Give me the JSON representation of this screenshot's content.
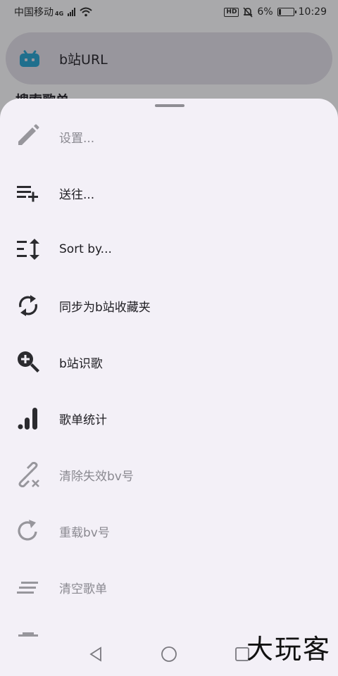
{
  "status": {
    "carrier": "中国移动",
    "network": "4G",
    "battery_percent": "6%",
    "time": "10:29",
    "hd_badge": "HD"
  },
  "search": {
    "icon": "bilibili-tv-icon",
    "text": "b站URL"
  },
  "behind": {
    "label": "搜索歌单"
  },
  "menu": [
    {
      "label": "设置...",
      "icon": "pencil-icon",
      "enabled": false
    },
    {
      "label": "送往...",
      "icon": "playlist-add-icon",
      "enabled": true
    },
    {
      "label": "Sort by...",
      "icon": "sort-icon",
      "enabled": true
    },
    {
      "label": "同步为b站收藏夹",
      "icon": "sync-icon",
      "enabled": true
    },
    {
      "label": "b站识歌",
      "icon": "zoom-in-icon",
      "enabled": true
    },
    {
      "label": "歌单统计",
      "icon": "bar-chart-icon",
      "enabled": true
    },
    {
      "label": "清除失效bv号",
      "icon": "link-off-icon",
      "enabled": false
    },
    {
      "label": "重载bv号",
      "icon": "reload-icon",
      "enabled": false
    },
    {
      "label": "清空歌单",
      "icon": "clear-list-icon",
      "enabled": false
    }
  ],
  "nav": {
    "back_icon": "back-triangle-icon",
    "home_icon": "home-circle-icon",
    "recents_icon": "recents-square-icon"
  },
  "watermark": "大玩客",
  "colors": {
    "sheet_bg": "#f3f0f7",
    "scrim": "#a9a9ab",
    "icon_enabled": "#2b2b2f",
    "icon_disabled": "#97969c",
    "bilibili_blue": "#1f6f8d"
  }
}
